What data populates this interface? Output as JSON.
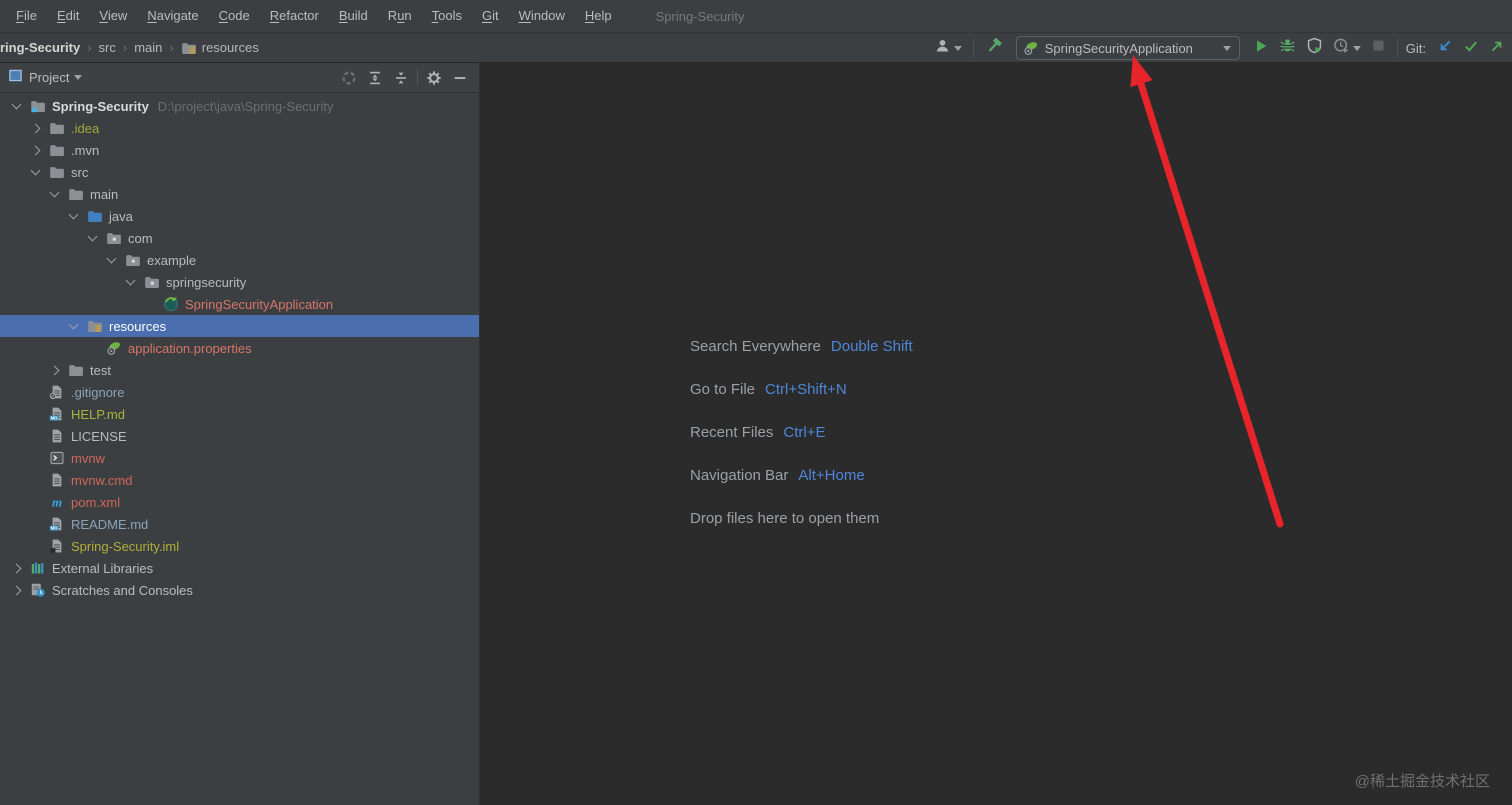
{
  "window": {
    "title": "Spring-Security"
  },
  "menubar": {
    "items": [
      {
        "label": "File",
        "mnemonic_index": 0
      },
      {
        "label": "Edit",
        "mnemonic_index": 0
      },
      {
        "label": "View",
        "mnemonic_index": 0
      },
      {
        "label": "Navigate",
        "mnemonic_index": 0
      },
      {
        "label": "Code",
        "mnemonic_index": 0
      },
      {
        "label": "Refactor",
        "mnemonic_index": 0
      },
      {
        "label": "Build",
        "mnemonic_index": 0
      },
      {
        "label": "Run",
        "mnemonic_index": 1
      },
      {
        "label": "Tools",
        "mnemonic_index": 0
      },
      {
        "label": "Git",
        "mnemonic_index": 0
      },
      {
        "label": "Window",
        "mnemonic_index": 0
      },
      {
        "label": "Help",
        "mnemonic_index": 0
      }
    ]
  },
  "breadcrumbs": {
    "items": [
      {
        "label": "ring-Security",
        "bold": true,
        "icon": null
      },
      {
        "label": "src",
        "bold": false,
        "icon": null
      },
      {
        "label": "main",
        "bold": false,
        "icon": null
      },
      {
        "label": "resources",
        "bold": false,
        "icon": "resources-folder"
      }
    ]
  },
  "run_toolbar": {
    "config_name": "SpringSecurityApplication",
    "git_label": "Git:"
  },
  "project_panel": {
    "title": "Project",
    "tree": [
      {
        "label": "Spring-Security",
        "suffix": "D:\\project\\java\\Spring-Security",
        "level": 0,
        "chevron": "expanded",
        "icon": "project-folder",
        "bold": true,
        "selected": false,
        "color": null
      },
      {
        "label": ".idea",
        "suffix": null,
        "level": 1,
        "chevron": "collapsed",
        "icon": "folder",
        "bold": false,
        "selected": false,
        "color": "#A2A838"
      },
      {
        "label": ".mvn",
        "suffix": null,
        "level": 1,
        "chevron": "collapsed",
        "icon": "folder",
        "bold": false,
        "selected": false,
        "color": null
      },
      {
        "label": "src",
        "suffix": null,
        "level": 1,
        "chevron": "expanded",
        "icon": "folder",
        "bold": false,
        "selected": false,
        "color": null
      },
      {
        "label": "main",
        "suffix": null,
        "level": 2,
        "chevron": "expanded",
        "icon": "folder",
        "bold": false,
        "selected": false,
        "color": null
      },
      {
        "label": "java",
        "suffix": null,
        "level": 3,
        "chevron": "expanded",
        "icon": "java-folder",
        "bold": false,
        "selected": false,
        "color": null
      },
      {
        "label": "com",
        "suffix": null,
        "level": 4,
        "chevron": "expanded",
        "icon": "package-folder",
        "bold": false,
        "selected": false,
        "color": null
      },
      {
        "label": "example",
        "suffix": null,
        "level": 5,
        "chevron": "expanded",
        "icon": "package-folder",
        "bold": false,
        "selected": false,
        "color": null
      },
      {
        "label": "springsecurity",
        "suffix": null,
        "level": 6,
        "chevron": "expanded",
        "icon": "package-folder",
        "bold": false,
        "selected": false,
        "color": null
      },
      {
        "label": "SpringSecurityApplication",
        "suffix": null,
        "level": 7,
        "chevron": "none",
        "icon": "spring-boot-class",
        "bold": false,
        "selected": false,
        "color": "#D8756A"
      },
      {
        "label": "resources",
        "suffix": null,
        "level": 3,
        "chevron": "expanded",
        "icon": "resources-folder",
        "bold": false,
        "selected": true,
        "color": null
      },
      {
        "label": "application.properties",
        "suffix": null,
        "level": 4,
        "chevron": "none",
        "icon": "spring-config",
        "bold": false,
        "selected": false,
        "color": "#D8756A"
      },
      {
        "label": "test",
        "suffix": null,
        "level": 2,
        "chevron": "collapsed",
        "icon": "folder",
        "bold": false,
        "selected": false,
        "color": null
      },
      {
        "label": ".gitignore",
        "suffix": null,
        "level": 1,
        "chevron": "none",
        "icon": "ignore-file",
        "bold": false,
        "selected": false,
        "color": "#8BA3B8"
      },
      {
        "label": "HELP.md",
        "suffix": null,
        "level": 1,
        "chevron": "none",
        "icon": "markdown-file",
        "bold": false,
        "selected": false,
        "color": "#A8B339"
      },
      {
        "label": "LICENSE",
        "suffix": null,
        "level": 1,
        "chevron": "none",
        "icon": "text-file",
        "bold": false,
        "selected": false,
        "color": null
      },
      {
        "label": "mvnw",
        "suffix": null,
        "level": 1,
        "chevron": "none",
        "icon": "shell-file",
        "bold": false,
        "selected": false,
        "color": "#D1675A"
      },
      {
        "label": "mvnw.cmd",
        "suffix": null,
        "level": 1,
        "chevron": "none",
        "icon": "text-file",
        "bold": false,
        "selected": false,
        "color": "#D1675A"
      },
      {
        "label": "pom.xml",
        "suffix": null,
        "level": 1,
        "chevron": "none",
        "icon": "maven-file",
        "bold": false,
        "selected": false,
        "color": "#D1675A"
      },
      {
        "label": "README.md",
        "suffix": null,
        "level": 1,
        "chevron": "none",
        "icon": "markdown-file",
        "bold": false,
        "selected": false,
        "color": "#8BA3B8"
      },
      {
        "label": "Spring-Security.iml",
        "suffix": null,
        "level": 1,
        "chevron": "none",
        "icon": "iml-file",
        "bold": false,
        "selected": false,
        "color": "#B3AC3A"
      },
      {
        "label": "External Libraries",
        "suffix": null,
        "level": 0,
        "chevron": "collapsed",
        "icon": "libraries",
        "bold": false,
        "selected": false,
        "color": null
      },
      {
        "label": "Scratches and Consoles",
        "suffix": null,
        "level": 0,
        "chevron": "collapsed",
        "icon": "scratches",
        "bold": false,
        "selected": false,
        "color": null
      }
    ]
  },
  "shortcuts": {
    "items": [
      {
        "label": "Search Everywhere",
        "shortcut": "Double Shift"
      },
      {
        "label": "Go to File",
        "shortcut": "Ctrl+Shift+N"
      },
      {
        "label": "Recent Files",
        "shortcut": "Ctrl+E"
      },
      {
        "label": "Navigation Bar",
        "shortcut": "Alt+Home"
      },
      {
        "label": "Drop files here to open them",
        "shortcut": null
      }
    ]
  },
  "watermark": {
    "text": "@稀土掘金技术社区"
  },
  "colors": {
    "panel_bg": "#3C3F41",
    "editor_bg": "#2B2B2B",
    "selection": "#4B6EAF",
    "shortcut_blue": "#4E86D9",
    "untracked_red": "#D1675A",
    "ignored_olive": "#A8B339",
    "modified_blue": "#8BA3B8",
    "run_green": "#4DA652",
    "annotation_arrow_red": "#E8242B"
  }
}
